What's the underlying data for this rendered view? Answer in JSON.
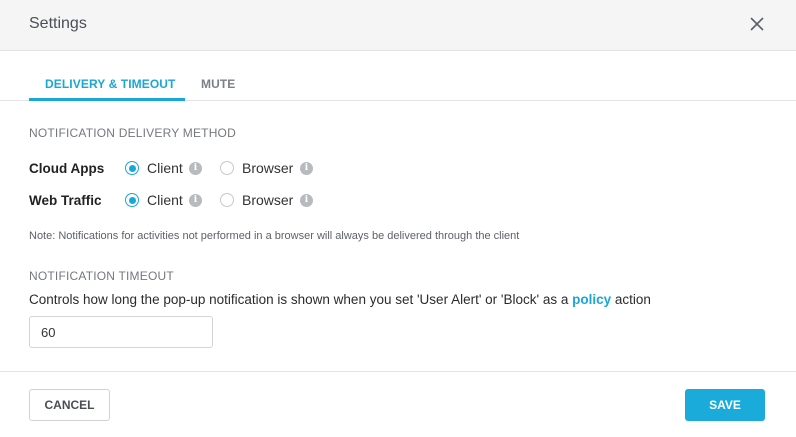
{
  "dialog": {
    "title": "Settings",
    "close_icon": "close-icon"
  },
  "tabs": [
    {
      "label": "DELIVERY & TIMEOUT",
      "active": true
    },
    {
      "label": "MUTE",
      "active": false
    }
  ],
  "delivery": {
    "section_label": "NOTIFICATION DELIVERY METHOD",
    "rows": [
      {
        "label": "Cloud Apps",
        "options": [
          {
            "label": "Client",
            "selected": true,
            "icon": "info-icon"
          },
          {
            "label": "Browser",
            "selected": false,
            "icon": "info-icon"
          }
        ]
      },
      {
        "label": "Web Traffic",
        "options": [
          {
            "label": "Client",
            "selected": true,
            "icon": "info-icon"
          },
          {
            "label": "Browser",
            "selected": false,
            "icon": "info-icon"
          }
        ]
      }
    ],
    "note": "Note: Notifications for activities not performed in a browser will always be delivered through the client"
  },
  "timeout": {
    "section_label": "NOTIFICATION TIMEOUT",
    "description_before": "Controls how long the pop-up notification is shown when you set 'User Alert' or 'Block' as a ",
    "description_link": "policy",
    "description_after": " action",
    "value": "60"
  },
  "footer": {
    "cancel_label": "CANCEL",
    "save_label": "SAVE"
  },
  "colors": {
    "accent": "#1aa6d6",
    "header_bg": "#f5f5f6"
  }
}
